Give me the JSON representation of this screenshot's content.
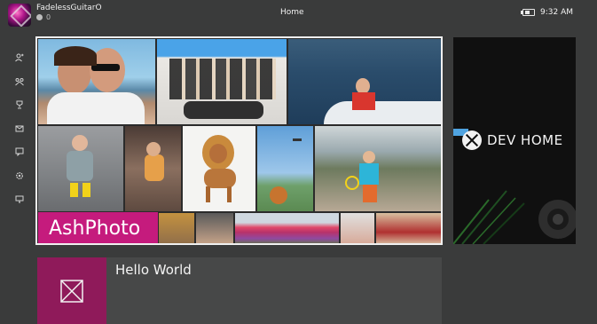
{
  "header": {
    "gamertag": "FadelessGuitarO",
    "gamerscore": "0",
    "page_title": "Home",
    "time": "9:32 AM"
  },
  "rail": {
    "items": [
      {
        "icon": "friends-icon"
      },
      {
        "icon": "party-icon"
      },
      {
        "icon": "achievements-icon"
      },
      {
        "icon": "messages-icon"
      },
      {
        "icon": "chat-icon"
      },
      {
        "icon": "settings-icon"
      },
      {
        "icon": "tv-icon"
      }
    ]
  },
  "tiles": {
    "featured": {
      "label": "AshPhoto",
      "accent_color": "#c51b7d"
    },
    "dev_home": {
      "label": "DEV HOME",
      "accent_color": "#4fa3e0"
    },
    "hello_world": {
      "label": "Hello World",
      "icon": "placeholder-image-icon",
      "accent_color": "#8f1a5a"
    }
  }
}
